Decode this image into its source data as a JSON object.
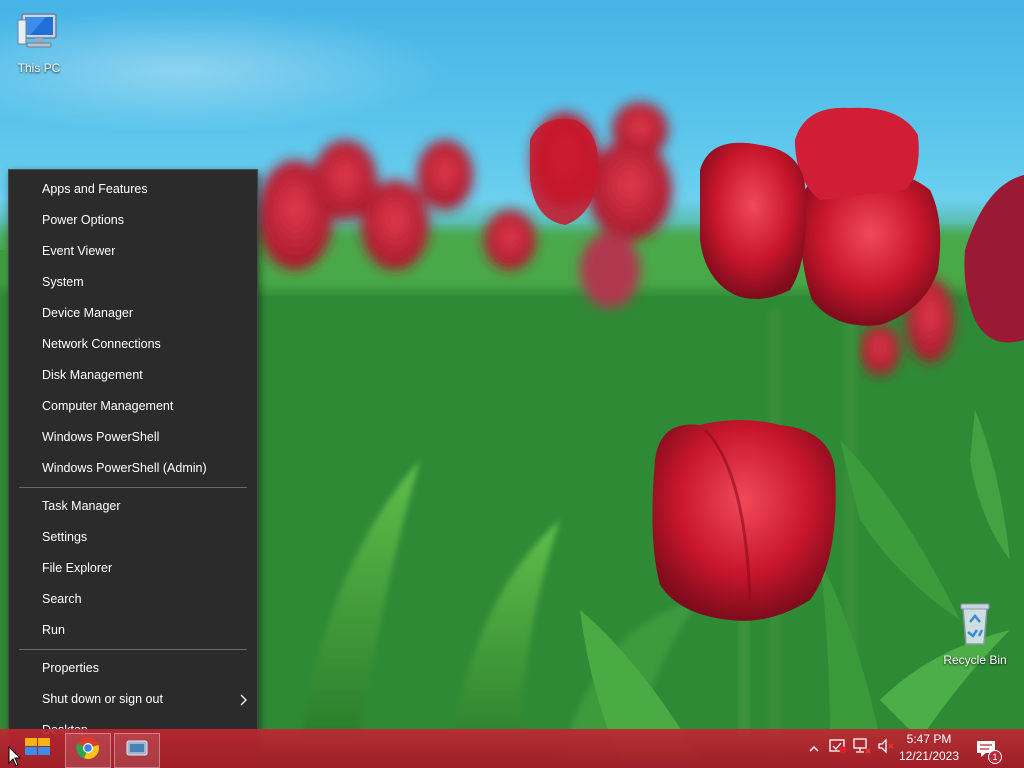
{
  "desktop": {
    "icons": [
      {
        "label": "This PC",
        "icon": "computer-icon"
      },
      {
        "label": "Recycle Bin",
        "icon": "recycle-bin-icon"
      }
    ]
  },
  "menu": {
    "group1": [
      "Apps and Features",
      "Power Options",
      "Event Viewer",
      "System",
      "Device Manager",
      "Network Connections",
      "Disk Management",
      "Computer Management",
      "Windows PowerShell",
      "Windows PowerShell (Admin)"
    ],
    "group2": [
      "Task Manager",
      "Settings",
      "File Explorer",
      "Search",
      "Run"
    ],
    "group3": [
      "Properties",
      "Shut down or sign out",
      "Desktop"
    ]
  },
  "taskbar": {
    "clock": {
      "time": "5:47 PM",
      "date": "12/21/2023"
    },
    "notification_count": "1",
    "tray_icons": [
      "chevron-up-icon",
      "security-icon",
      "network-icon",
      "volume-muted-icon"
    ],
    "pinned": [
      "start-icon",
      "chrome-icon",
      "pinned-app-icon"
    ]
  },
  "colors": {
    "menu_bg": "#2b2b2b",
    "menu_text": "#ffffff",
    "taskbar": "#b8283a"
  }
}
